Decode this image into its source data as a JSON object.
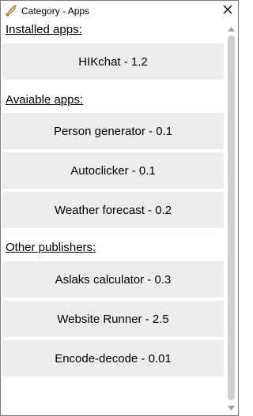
{
  "window": {
    "title": "Category - Apps",
    "app_icon": "rocket-icon",
    "close_icon": "close-icon"
  },
  "sections": {
    "installed": {
      "label": "Installed apps:",
      "items": [
        "HIKchat - 1.2"
      ]
    },
    "available": {
      "label": "Avaiable apps:",
      "items": [
        "Person generator - 0.1",
        "Autoclicker - 0.1",
        "Weather forecast - 0.2"
      ]
    },
    "other": {
      "label": "Other publishers:",
      "items": [
        "Aslaks calculator - 0.3",
        "Website Runner - 2.5",
        "Encode-decode - 0.01"
      ]
    }
  },
  "colors": {
    "row_background": "#ececec",
    "scroll_thumb": "#cfcfcf"
  }
}
